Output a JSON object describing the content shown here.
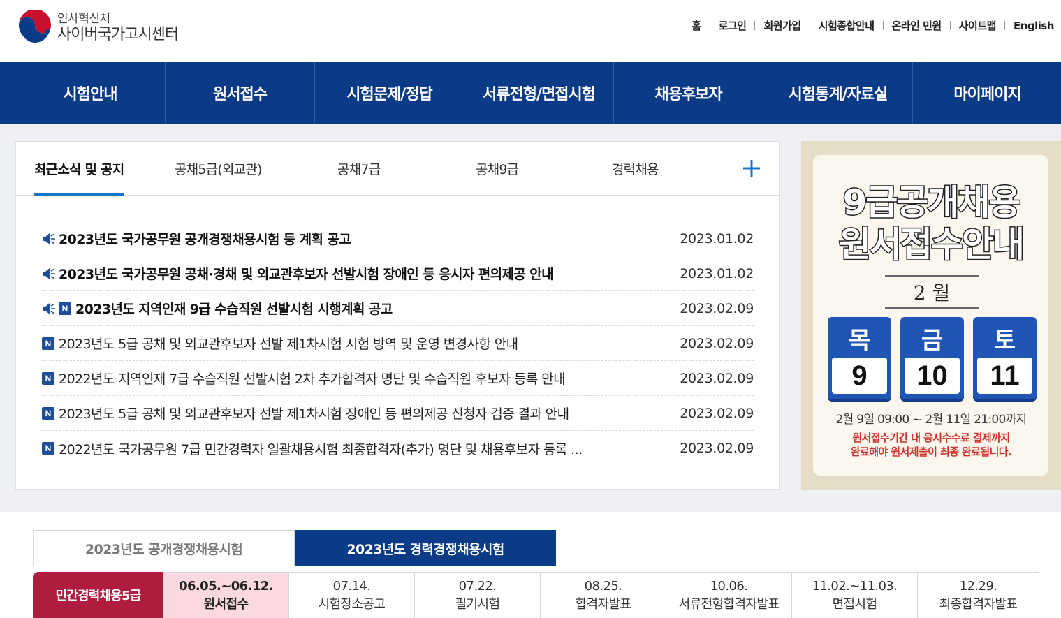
{
  "header": {
    "org_name": "인사혁신처",
    "site_title": "사이버국가고시센터",
    "util_links": [
      "홈",
      "로그인",
      "회원가입",
      "시험종합안내",
      "온라인 민원",
      "사이트맵",
      "English"
    ]
  },
  "gnb": {
    "items": [
      "시험안내",
      "원서접수",
      "시험문제/정답",
      "서류전형/면접시험",
      "채용후보자",
      "시험통계/자료실",
      "마이페이지"
    ]
  },
  "notices": {
    "tabs": [
      "최근소식 및 공지",
      "공채5급(외교관)",
      "공채7급",
      "공채9급",
      "경력채용"
    ],
    "more_label": "+",
    "items": [
      {
        "title": "2023년도 국가공무원 공개경쟁채용시험 등 계획 공고",
        "date": "2023.01.02",
        "speaker": true,
        "new": false,
        "bold": true
      },
      {
        "title": "2023년도 국가공무원 공채·경채 및 외교관후보자 선발시험 장애인 등 응시자 편의제공 안내",
        "date": "2023.01.02",
        "speaker": true,
        "new": false,
        "bold": true
      },
      {
        "title": "2023년도 지역인재 9급 수습직원 선발시험 시행계획 공고",
        "date": "2023.02.09",
        "speaker": true,
        "new": true,
        "bold": true
      },
      {
        "title": "2023년도 5급 공채 및 외교관후보자 선발 제1차시험 시험 방역 및 운영 변경사항 안내",
        "date": "2023.02.09",
        "speaker": false,
        "new": true,
        "bold": false
      },
      {
        "title": "2022년도 지역인재 7급 수습직원 선발시험 2차 추가합격자 명단 및 수습직원 후보자 등록 안내",
        "date": "2023.02.09",
        "speaker": false,
        "new": true,
        "bold": false
      },
      {
        "title": "2023년도 5급 공채 및 외교관후보자 선발 제1차시험 장애인 등 편의제공 신청자 검증 결과 안내",
        "date": "2023.02.09",
        "speaker": false,
        "new": true,
        "bold": false
      },
      {
        "title": "2022년도 국가공무원 7급 민간경력자 일괄채용시험 최종합격자(추가) 명단 및 채용후보자 등록 ...",
        "date": "2023.02.09",
        "speaker": false,
        "new": true,
        "bold": false
      }
    ],
    "new_badge": "N"
  },
  "banner": {
    "title_line1": "9급공개채용",
    "title_line2": "원서접수안내",
    "month": "2 월",
    "days": [
      {
        "dow": "목",
        "date": "9"
      },
      {
        "dow": "금",
        "date": "10"
      },
      {
        "dow": "토",
        "date": "11"
      }
    ],
    "period": "2월 9일 09:00 ~ 2월 11일 21:00까지",
    "note_line1": "원서접수기간 내 응시수수료 결제까지",
    "note_line2": "완료해야 원서제출이 최종 완료됩니다."
  },
  "schedule": {
    "tabs": [
      "2023년도 공개경쟁채용시험",
      "2023년도 경력경쟁채용시험"
    ],
    "active_tab": 1,
    "row_label": "민간경력채용5급",
    "steps": [
      {
        "date": "06.05.~06.12.",
        "label": "원서접수",
        "current": true
      },
      {
        "date": "07.14.",
        "label": "시험장소공고",
        "current": false
      },
      {
        "date": "07.22.",
        "label": "필기시험",
        "current": false
      },
      {
        "date": "08.25.",
        "label": "합격자발표",
        "current": false
      },
      {
        "date": "10.06.",
        "label": "서류전형합격자발표",
        "current": false
      },
      {
        "date": "11.02.~11.03.",
        "label": "면접시험",
        "current": false
      },
      {
        "date": "12.29.",
        "label": "최종합격자발표",
        "current": false
      }
    ]
  },
  "colors": {
    "primary": "#0b3a86",
    "accent": "#1a73c9",
    "schedule_label": "#b01c3d",
    "current_step": "#fbd9e1",
    "banner_blue": "#1f56b5",
    "banner_note": "#d0332b"
  }
}
